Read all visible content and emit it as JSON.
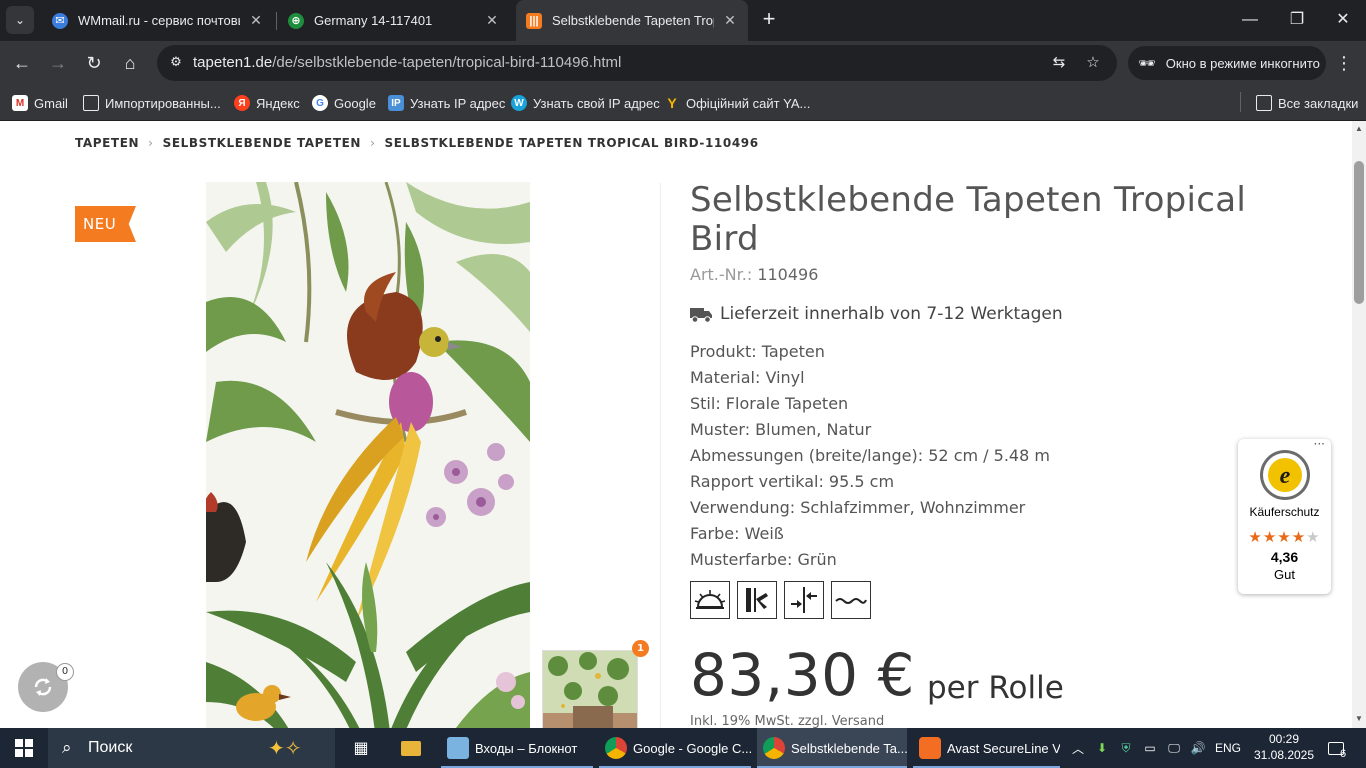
{
  "browser": {
    "tabs": [
      {
        "title": "WMmail.ru - сервис почтовых",
        "icon": "wmmail-icon"
      },
      {
        "title": "Germany 14-117401",
        "icon": "globe-icon"
      },
      {
        "title": "Selbstklebende Tapeten Tropica",
        "icon": "tapeten1-icon"
      }
    ],
    "url_host": "tapeten1.de",
    "url_path": "/de/selbstklebende-tapeten/tropical-bird-110496.html",
    "incognito_label": "Окно в режиме инкогнито",
    "bookmarks": [
      {
        "label": "Gmail",
        "icon": "gmail-icon"
      },
      {
        "label": "Импортированны...",
        "icon": "folder-icon"
      },
      {
        "label": "Яндекс",
        "icon": "yandex-icon"
      },
      {
        "label": "Google",
        "icon": "google-icon"
      },
      {
        "label": "Узнать IP адрес",
        "icon": "ip-icon"
      },
      {
        "label": "Узнать свой IP адрес",
        "icon": "w-icon"
      },
      {
        "label": "Офіційний сайт YA...",
        "icon": "ya-icon"
      }
    ],
    "all_bookmarks_label": "Все закладки"
  },
  "page": {
    "breadcrumb": [
      "TAPETEN",
      "SELBSTKLEBENDE TAPETEN",
      "SELBSTKLEBENDE TAPETEN TROPICAL BIRD-110496"
    ],
    "badge_new": "NEU",
    "thumb_badge_count": "1",
    "title": "Selbstklebende Tapeten Tropical Bird",
    "art_label": "Art.-Nr.:",
    "art_nr": "110496",
    "delivery": "Lieferzeit innerhalb von 7-12 Werktagen",
    "specs": [
      "Produkt: Tapeten",
      "Material: Vinyl",
      "Stil: Florale Tapeten",
      "Muster: Blumen, Natur",
      "Abmessungen (breite/lange): 52 cm / 5.48 m",
      "Rapport vertikal: 95.5 cm",
      "Verwendung: Schlafzimmer, Wohnzimmer",
      "Farbe: Weiß",
      "Musterfarbe: Grün"
    ],
    "symbols": [
      "lightfastness-icon",
      "paste-the-wall-icon",
      "straight-match-icon",
      "washable-icon"
    ],
    "price": "83,30 €",
    "per_unit": "per Rolle",
    "vat_note": "Inkl. 19% MwSt. zzgl. Versand",
    "compare_count": "0"
  },
  "trusted_shops": {
    "label": "Käuferschutz",
    "rating": "4,36",
    "rating_value": 4.36,
    "rating_max": 5,
    "rating_word": "Gut",
    "menu": "···"
  },
  "taskbar": {
    "search_label": "Поиск",
    "apps": [
      {
        "label": "Входы – Блокнот",
        "icon": "notepad-icon"
      },
      {
        "label": "Google - Google C...",
        "icon": "chrome-icon"
      },
      {
        "label": "Selbstklebende Ta...",
        "icon": "chrome-icon"
      },
      {
        "label": "Avast SecureLine V...",
        "icon": "avast-icon"
      }
    ],
    "language": "ENG",
    "time": "00:29",
    "date": "31.08.2025",
    "notifications": "6"
  },
  "colors": {
    "accent_orange": "#f47b20",
    "chrome_dark": "#202124",
    "chrome_toolbar": "#35363a",
    "taskbar": "#1c2634"
  }
}
